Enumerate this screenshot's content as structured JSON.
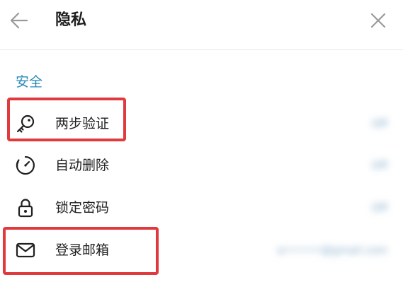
{
  "header": {
    "title": "隐私",
    "back_icon": "arrow-left-icon",
    "close_icon": "close-icon"
  },
  "section": {
    "title": "安全"
  },
  "rows": [
    {
      "label": "两步验证",
      "value": "Off",
      "icon": "key-icon"
    },
    {
      "label": "自动删除",
      "value": "Off",
      "icon": "timer-icon"
    },
    {
      "label": "锁定密码",
      "value": "Off",
      "icon": "lock-icon"
    },
    {
      "label": "登录邮箱",
      "value": "a••••••@gmail.com",
      "icon": "mail-icon"
    }
  ],
  "colors": {
    "accent": "#2a8ab7",
    "highlight": "#e0393e"
  }
}
